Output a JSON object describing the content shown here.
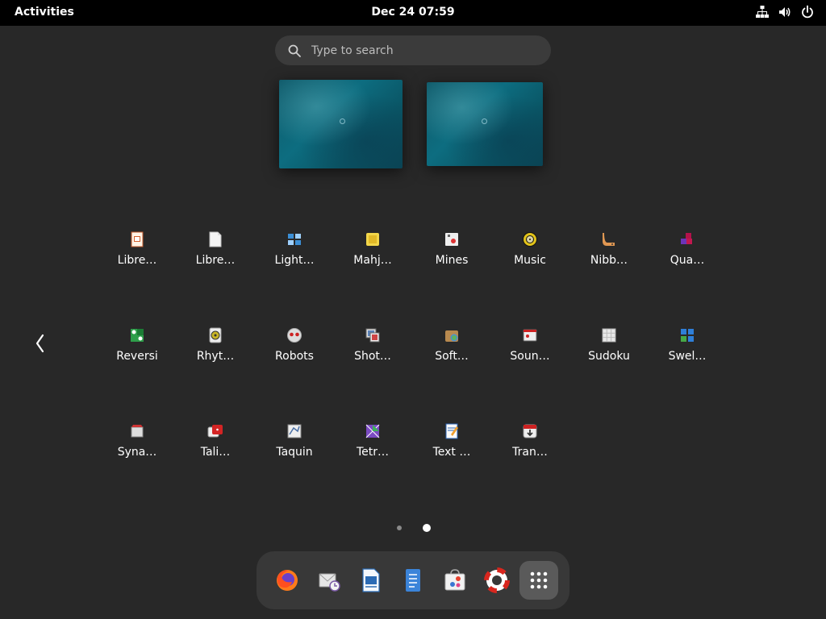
{
  "topbar": {
    "activities": "Activities",
    "clock": "Dec 24  07:59",
    "tray": [
      "network-icon",
      "volume-icon",
      "power-icon"
    ]
  },
  "search": {
    "placeholder": "Type to search"
  },
  "apps": [
    {
      "label": "Libre…",
      "icon": "libreoffice-impress-icon"
    },
    {
      "label": "Libre…",
      "icon": "libreoffice-writer-icon"
    },
    {
      "label": "Light…",
      "icon": "lightsoff-icon"
    },
    {
      "label": "Mahj…",
      "icon": "mahjongg-icon"
    },
    {
      "label": "Mines",
      "icon": "mines-icon"
    },
    {
      "label": "Music",
      "icon": "music-icon"
    },
    {
      "label": "Nibb…",
      "icon": "nibbles-icon"
    },
    {
      "label": "Qua…",
      "icon": "quadrapassel-icon"
    },
    {
      "label": "Reversi",
      "icon": "reversi-icon"
    },
    {
      "label": "Rhyt…",
      "icon": "rhythmbox-icon"
    },
    {
      "label": "Robots",
      "icon": "robots-icon"
    },
    {
      "label": "Shot…",
      "icon": "shotwell-icon"
    },
    {
      "label": "Soft…",
      "icon": "software-properties-icon"
    },
    {
      "label": "Soun…",
      "icon": "sound-recorder-icon"
    },
    {
      "label": "Sudoku",
      "icon": "sudoku-icon"
    },
    {
      "label": "Swel…",
      "icon": "swell-foop-icon"
    },
    {
      "label": "Syna…",
      "icon": "synaptic-icon"
    },
    {
      "label": "Tali…",
      "icon": "tali-icon"
    },
    {
      "label": "Taquin",
      "icon": "taquin-icon"
    },
    {
      "label": "Tetr…",
      "icon": "tetravex-icon"
    },
    {
      "label": "Text …",
      "icon": "text-editor-icon"
    },
    {
      "label": "Tran…",
      "icon": "transmission-icon"
    }
  ],
  "pager": {
    "pages": 2,
    "current": 2
  },
  "dock": [
    {
      "name": "firefox-icon"
    },
    {
      "name": "mail-clock-icon"
    },
    {
      "name": "libreoffice-writer-icon"
    },
    {
      "name": "text-document-icon"
    },
    {
      "name": "software-store-icon"
    },
    {
      "name": "help-lifebuoy-icon"
    },
    {
      "name": "app-grid-icon",
      "active": true
    }
  ],
  "colors": {
    "panel": "#000000",
    "background": "#282828",
    "dock": "#383838",
    "search": "#3b3b3b"
  }
}
